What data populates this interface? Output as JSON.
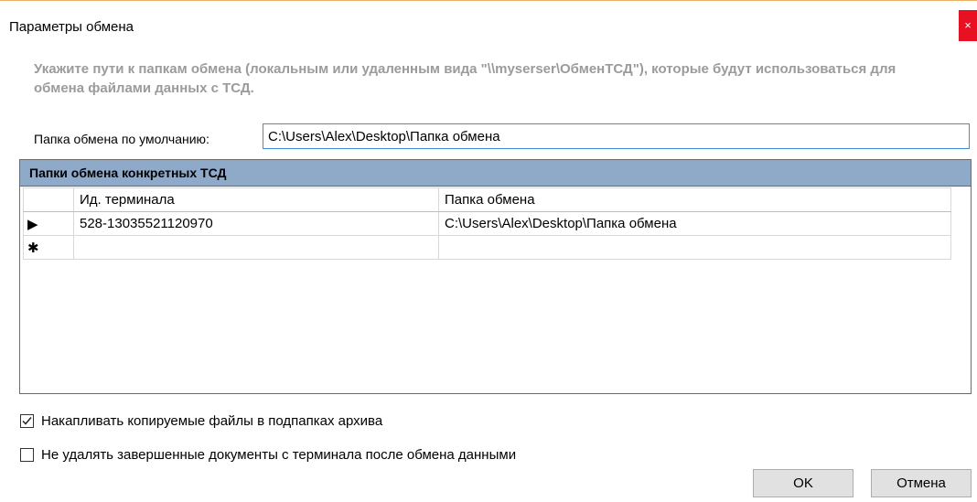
{
  "window": {
    "title": "Параметры обмена",
    "close_glyph": "×"
  },
  "description": "Укажите пути к папкам обмена (локальным или удаленным вида \"\\\\myserser\\ОбменТСД\"), которые будут использоваться для обмена файлами данных с ТСД.",
  "default_folder": {
    "label": "Папка обмена по умолчанию:",
    "value": "C:\\Users\\Alex\\Desktop\\Папка обмена"
  },
  "grid": {
    "caption": "Папки обмена конкретных ТСД",
    "columns": [
      "Ид. терминала",
      "Папка обмена"
    ],
    "rows": [
      {
        "marker": "▶",
        "terminal_id": "528-13035521120970",
        "folder": "C:\\Users\\Alex\\Desktop\\Папка обмена"
      }
    ],
    "new_row_marker": "✱"
  },
  "options": {
    "accumulate_label": "Накапливать копируемые файлы в подпапках архива",
    "accumulate_checked": true,
    "keep_docs_label": "Не удалять завершенные документы с терминала после обмена данными",
    "keep_docs_checked": false
  },
  "buttons": {
    "ok": "OK",
    "cancel": "Отмена"
  }
}
